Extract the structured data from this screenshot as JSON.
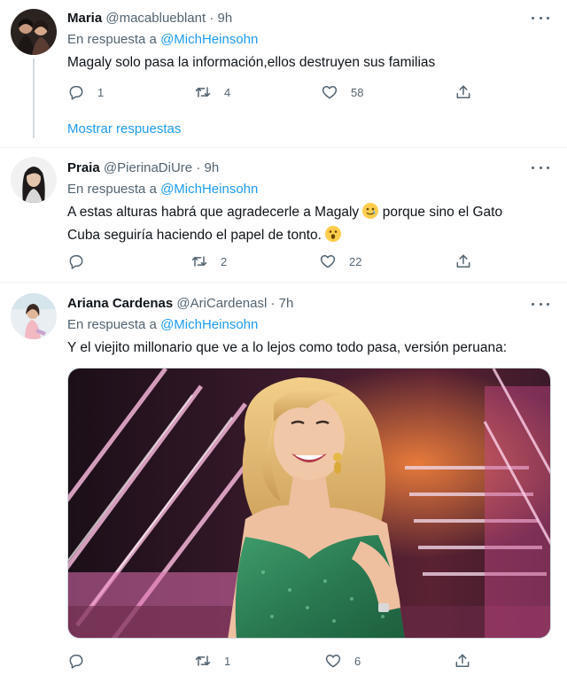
{
  "tweets": [
    {
      "name": "Maria",
      "handle": "@macablueblant",
      "dot": "·",
      "time": "9h",
      "replying_prefix": "En respuesta a",
      "replying_to": "@MichHeinsohn",
      "text": "Magaly solo pasa la información,ellos destruyen sus familias",
      "replies": "1",
      "retweets": "4",
      "likes": "58",
      "show_replies_label": "Mostrar respuestas"
    },
    {
      "name": "Praia",
      "handle": "@PierinaDiUre",
      "dot": "·",
      "time": "9h",
      "replying_prefix": "En respuesta a",
      "replying_to": "@MichHeinsohn",
      "text_line1_a": "A estas alturas habrá que agradecerle a Magaly ",
      "text_line1_b": " porque sino el Gato",
      "text_line2": "Cuba seguiría haciendo el papel de tonto. ",
      "replies": "",
      "retweets": "2",
      "likes": "22"
    },
    {
      "name": "Ariana Cardenas",
      "handle": "@AriCardenasl",
      "dot": "·",
      "time": "7h",
      "replying_prefix": "En respuesta a",
      "replying_to": "@MichHeinsohn",
      "text": "Y el viejito millonario que ve a lo lejos como todo pasa, versión peruana:",
      "replies": "",
      "retweets": "1",
      "likes": "6"
    }
  ],
  "icons": {
    "reply": "reply-icon",
    "retweet": "retweet-icon",
    "like": "heart-icon",
    "share": "share-icon",
    "more": "more-icon"
  },
  "colors": {
    "link": "#1d9bf0",
    "secondary": "#536471",
    "text": "#0f1419"
  }
}
